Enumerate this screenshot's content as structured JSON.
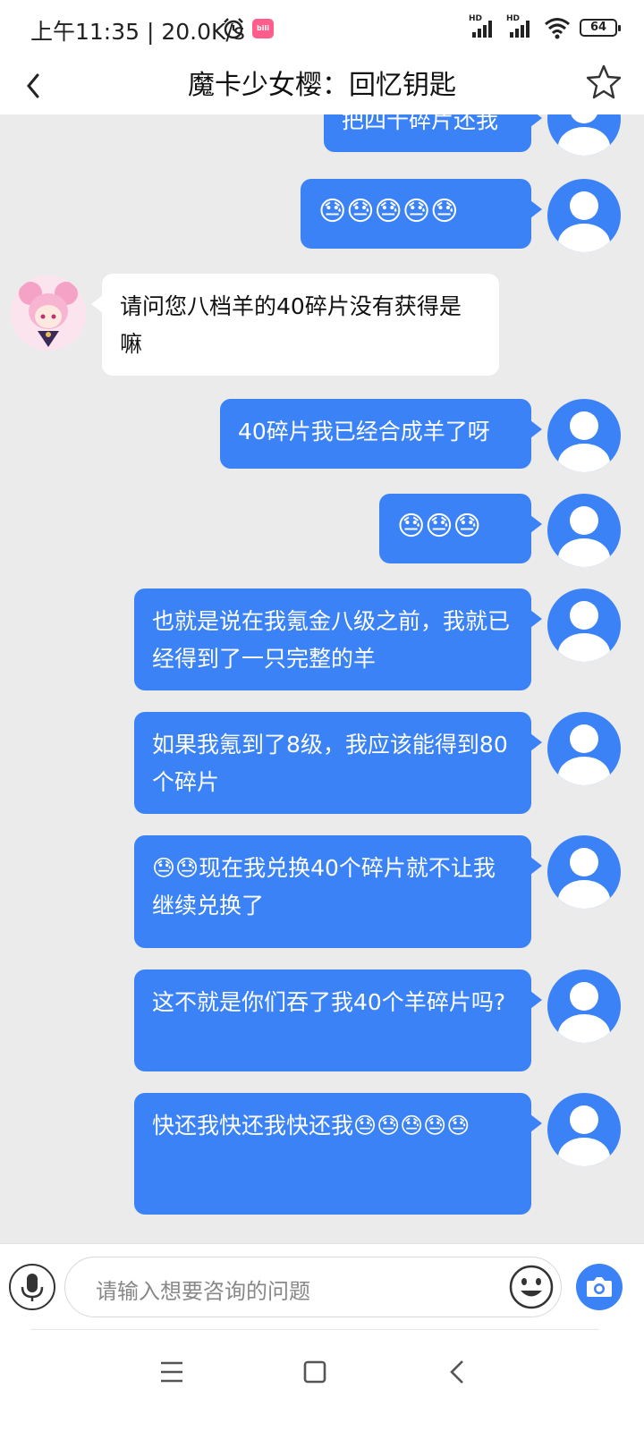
{
  "status_bar": {
    "time": "上午11:35",
    "speed": "20.0K/s",
    "network_label": "HD",
    "battery": "64",
    "app_badge": "bilibili"
  },
  "nav": {
    "title": "魔卡少女樱：回忆钥匙"
  },
  "chat": {
    "messages": [
      {
        "from": "user",
        "text": "把四十碎片还我"
      },
      {
        "from": "user",
        "text": "😓😓😓😓😓"
      },
      {
        "from": "bot",
        "text": "请问您八档羊的40碎片没有获得是嘛"
      },
      {
        "from": "user",
        "text": "40碎片我已经合成羊了呀"
      },
      {
        "from": "user",
        "text": "😓😓😓"
      },
      {
        "from": "user",
        "text": "也就是说在我氪金八级之前，我就已经得到了一只完整的羊"
      },
      {
        "from": "user",
        "text": "如果我氪到了8级，我应该能得到80个碎片"
      },
      {
        "from": "user",
        "text": "😓😓现在我兑换40个碎片就不让我继续兑换了"
      },
      {
        "from": "user",
        "text": "这不就是你们吞了我40个羊碎片吗?"
      },
      {
        "from": "user",
        "text": "快还我快还我快还我😓😓😓😓😓"
      }
    ]
  },
  "input": {
    "placeholder": "请输入想要咨询的问题"
  },
  "colors": {
    "accent": "#3b82f6",
    "chat_bg": "#ebebeb"
  },
  "icons": [
    "back-chevron-icon",
    "star-icon",
    "microphone-icon",
    "smiley-icon",
    "camera-icon",
    "menu-icon",
    "home-square-icon",
    "back-triangle-icon"
  ]
}
